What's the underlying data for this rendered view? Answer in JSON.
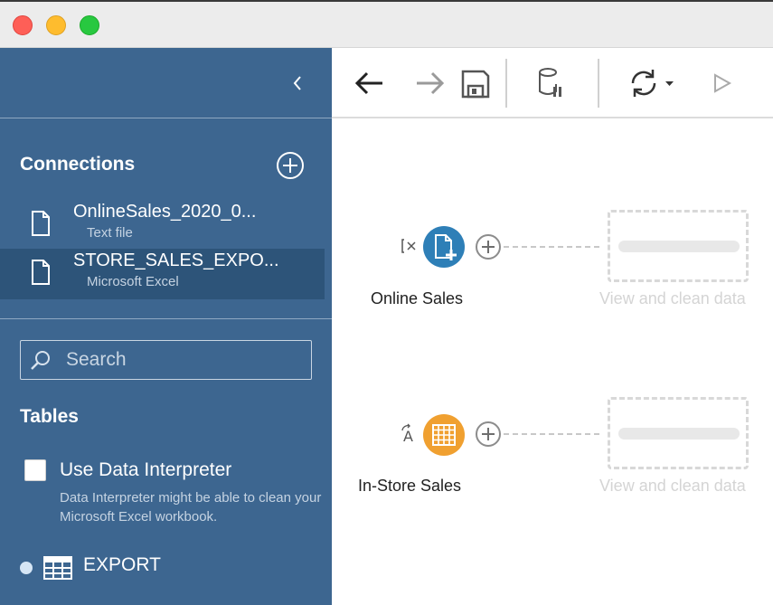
{
  "sidebar": {
    "connections_title": "Connections",
    "connections": [
      {
        "name": "OnlineSales_2020_0...",
        "type": "Text file",
        "icon": "text-file-icon",
        "selected": false
      },
      {
        "name": "STORE_SALES_EXPO...",
        "type": "Microsoft Excel",
        "icon": "text-file-icon",
        "selected": true
      }
    ],
    "search": {
      "placeholder": "Search",
      "value": ""
    },
    "tables_title": "Tables",
    "data_interpreter": {
      "label": "Use Data Interpreter",
      "checked": false,
      "help": "Data Interpreter might be able to clean your Microsoft Excel workbook."
    },
    "tables": [
      {
        "name": "EXPORT",
        "icon": "table-icon"
      }
    ]
  },
  "toolbar": {
    "buttons": [
      "back-icon",
      "forward-icon",
      "save-icon",
      "pause-data-updates-icon",
      "refresh-icon",
      "run-flow-icon"
    ]
  },
  "flow": {
    "nodes": [
      {
        "label": "Online Sales",
        "icon": "add-file-icon",
        "color": "#2e7fb7",
        "next_step_label": "View and clean data"
      },
      {
        "label": "In-Store Sales",
        "icon": "table-icon",
        "color": "#f0a030",
        "next_step_label": "View and clean data"
      }
    ]
  },
  "colors": {
    "sidebar_bg": "#3d6690",
    "sidebar_selected": "#2d5479",
    "online_node": "#2e7fb7",
    "instore_node": "#f0a030"
  }
}
